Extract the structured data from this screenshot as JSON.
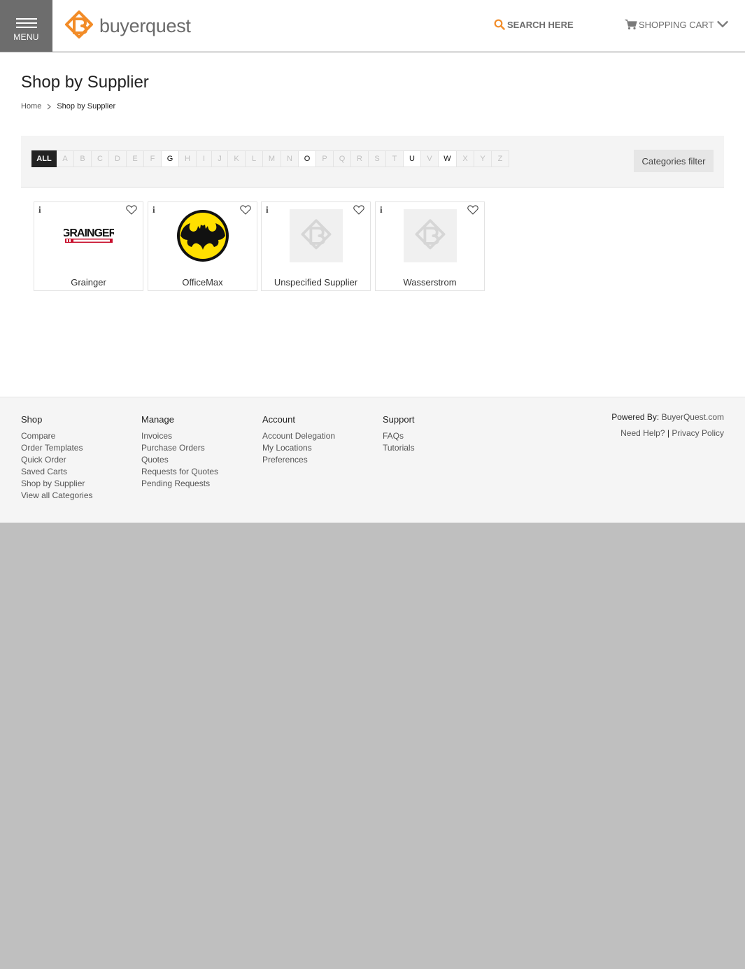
{
  "header": {
    "menu_label": "MENU",
    "logo_text": "buyerquest",
    "search_label": "SEARCH HERE",
    "cart_label": "SHOPPING CART",
    "accent_color": "#f28c28"
  },
  "page": {
    "title": "Shop by Supplier",
    "breadcrumb": [
      "Home",
      "Shop by Supplier"
    ]
  },
  "filter": {
    "all_label": "ALL",
    "letters": [
      {
        "l": "A",
        "on": false
      },
      {
        "l": "B",
        "on": false
      },
      {
        "l": "C",
        "on": false
      },
      {
        "l": "D",
        "on": false
      },
      {
        "l": "E",
        "on": false
      },
      {
        "l": "F",
        "on": false
      },
      {
        "l": "G",
        "on": true
      },
      {
        "l": "H",
        "on": false
      },
      {
        "l": "I",
        "on": false
      },
      {
        "l": "J",
        "on": false
      },
      {
        "l": "K",
        "on": false
      },
      {
        "l": "L",
        "on": false
      },
      {
        "l": "M",
        "on": false
      },
      {
        "l": "N",
        "on": false
      },
      {
        "l": "O",
        "on": true
      },
      {
        "l": "P",
        "on": false
      },
      {
        "l": "Q",
        "on": false
      },
      {
        "l": "R",
        "on": false
      },
      {
        "l": "S",
        "on": false
      },
      {
        "l": "T",
        "on": false
      },
      {
        "l": "U",
        "on": true
      },
      {
        "l": "V",
        "on": false
      },
      {
        "l": "W",
        "on": true
      },
      {
        "l": "X",
        "on": false
      },
      {
        "l": "Y",
        "on": false
      },
      {
        "l": "Z",
        "on": false
      }
    ],
    "categories_label": "Categories filter"
  },
  "suppliers": [
    {
      "name": "Grainger",
      "logo": "grainger-logo",
      "logo_text": "GRAINGER"
    },
    {
      "name": "OfficeMax",
      "logo": "batman-logo"
    },
    {
      "name": "Unspecified Supplier",
      "logo": "placeholder-logo"
    },
    {
      "name": "Wasserstrom",
      "logo": "placeholder-logo"
    }
  ],
  "supplier_info_glyph": "i",
  "footer": {
    "columns": [
      {
        "title": "Shop",
        "links": [
          "Compare",
          "Order Templates",
          "Quick Order",
          "Saved Carts",
          "Shop by Supplier",
          "View all Categories"
        ]
      },
      {
        "title": "Manage",
        "links": [
          "Invoices",
          "Purchase Orders",
          "Quotes",
          "Requests for Quotes",
          "Pending Requests"
        ]
      },
      {
        "title": "Account",
        "links": [
          "Account Delegation",
          "My Locations",
          "Preferences"
        ]
      },
      {
        "title": "Support",
        "links": [
          "FAQs",
          "Tutorials"
        ]
      }
    ],
    "powered_by_label": "Powered By:",
    "powered_by_link": "BuyerQuest.com",
    "need_help": "Need Help?",
    "separator": "|",
    "privacy": "Privacy Policy"
  }
}
